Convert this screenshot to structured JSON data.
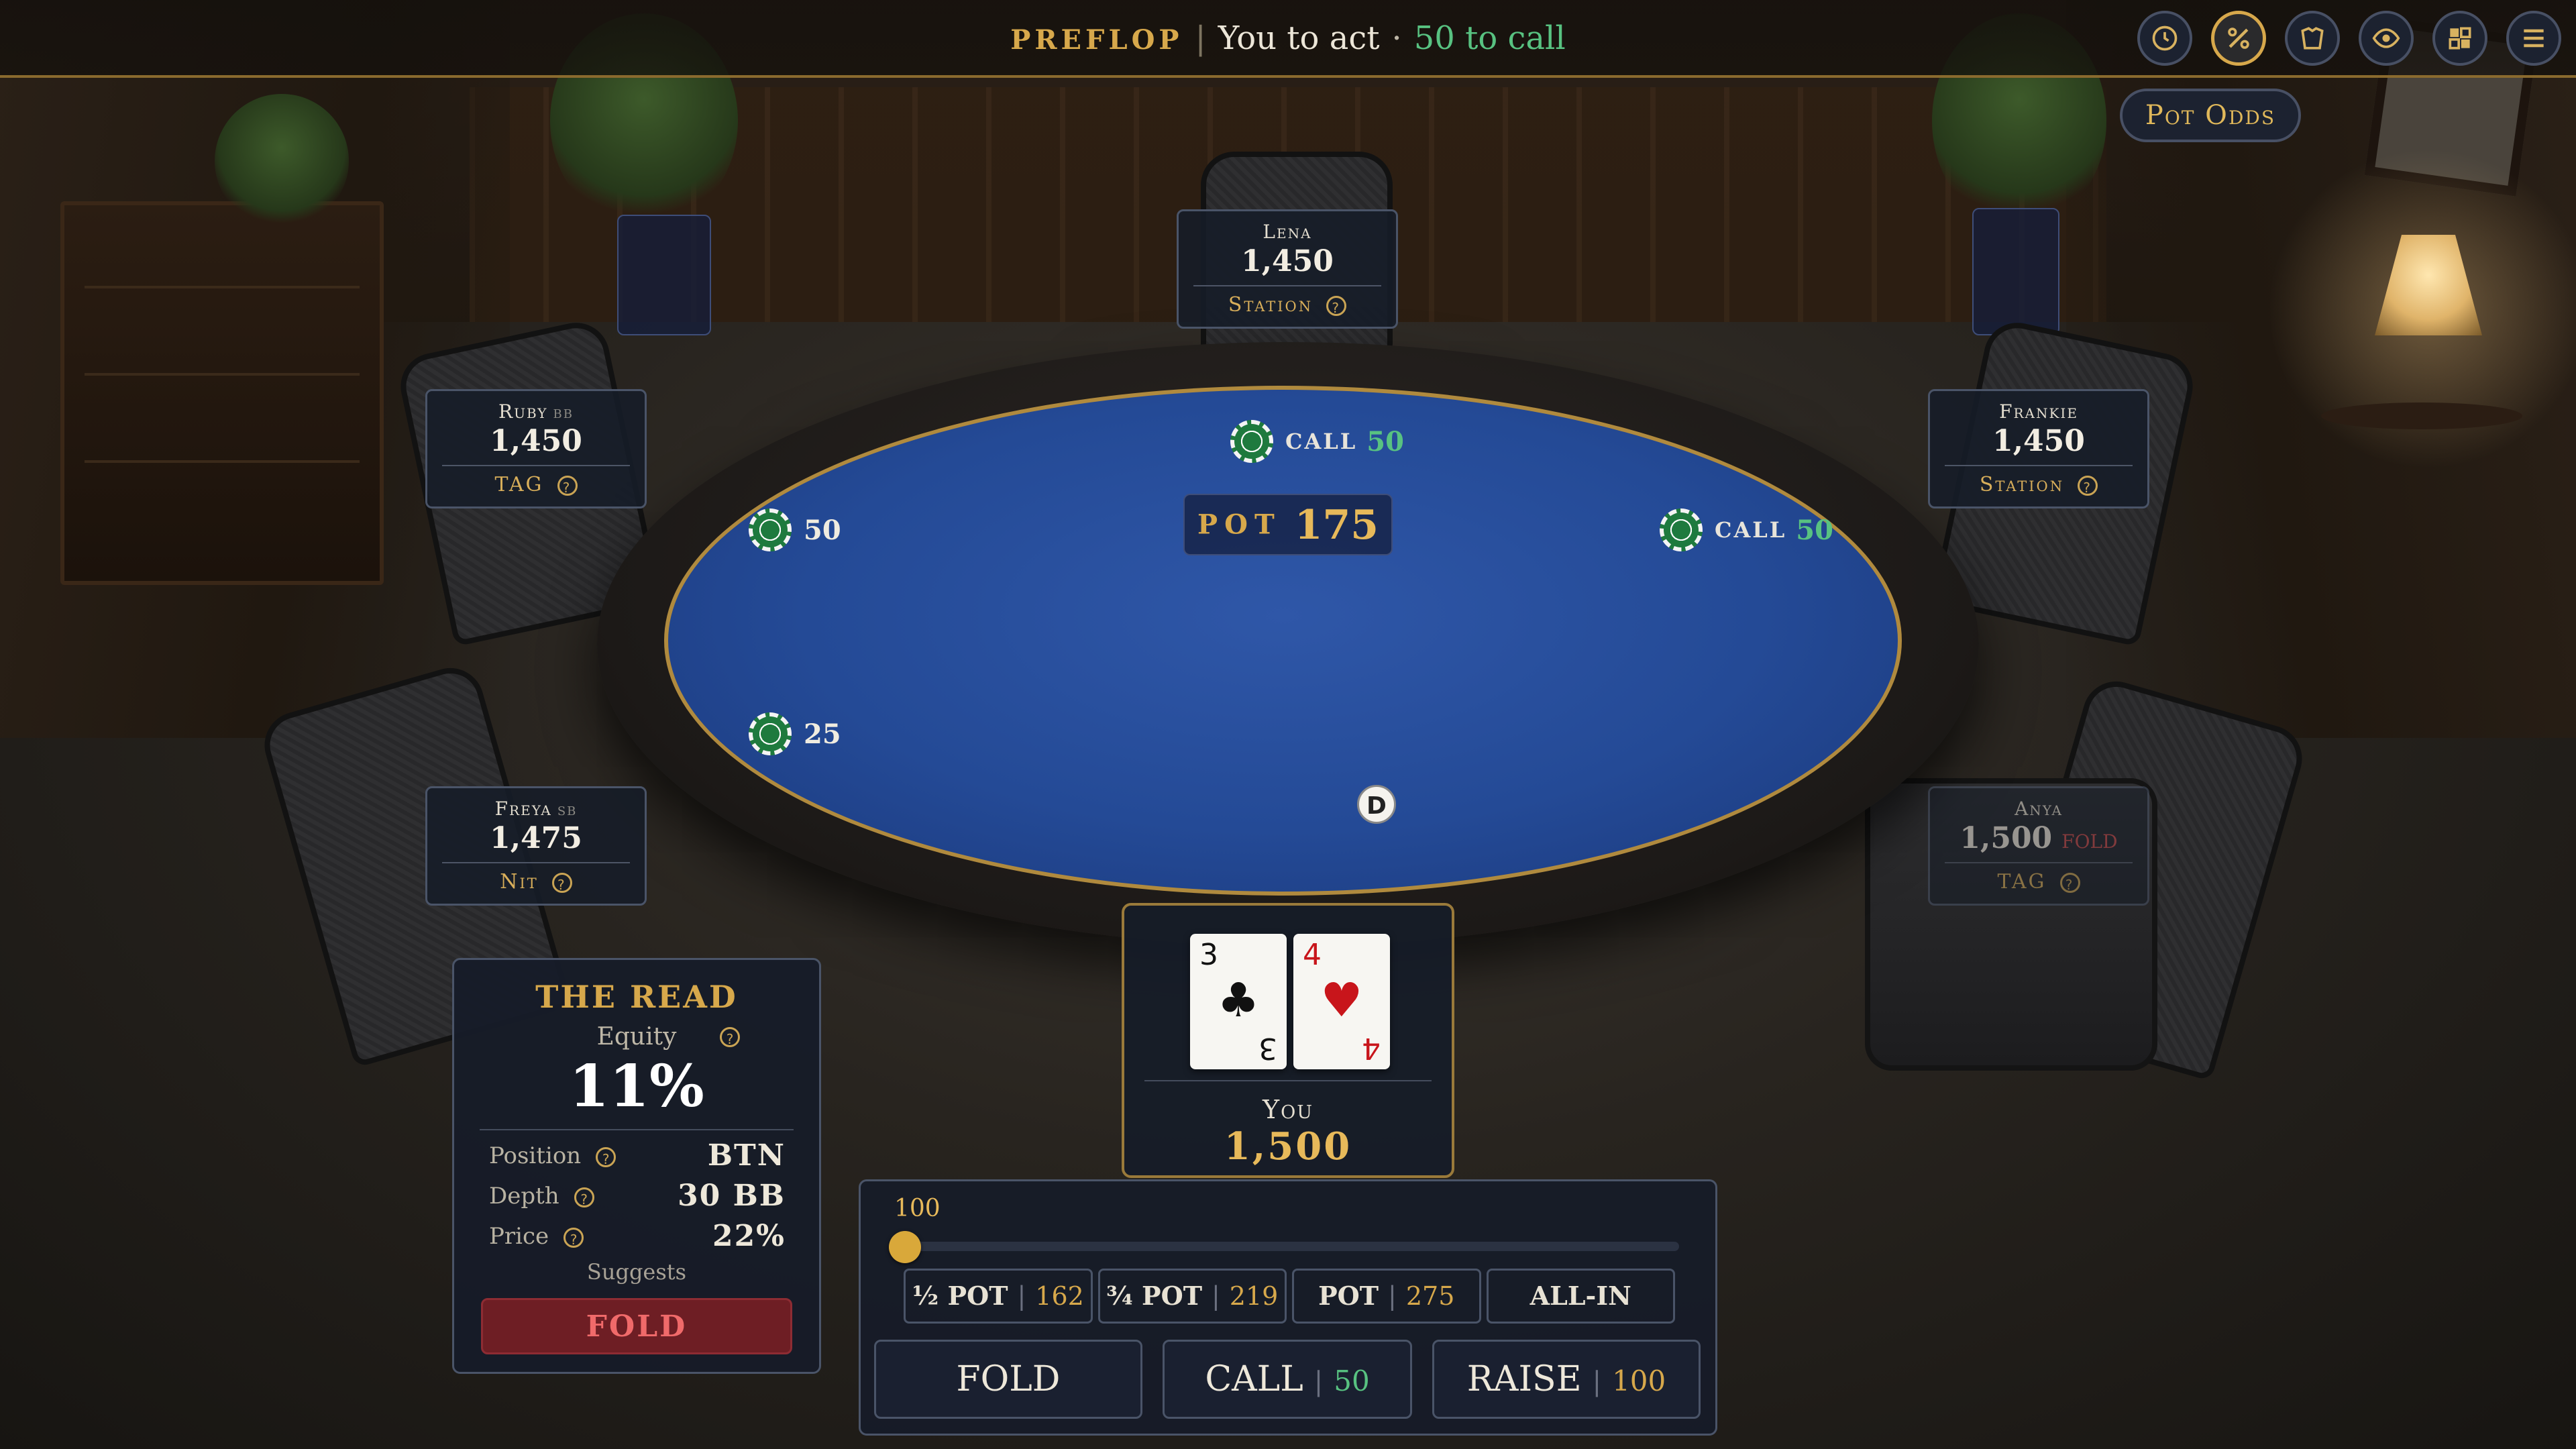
{
  "header": {
    "street": "PREFLOP",
    "status": "You to act",
    "to_call": "50 to call",
    "toolbar_icons": [
      "clock-icon",
      "percent-icon",
      "hand-rankings-icon",
      "eye-icon",
      "layout-icon",
      "menu-icon"
    ],
    "active_icon": "percent-icon",
    "tooltip": "Pot Odds"
  },
  "players": {
    "lena": {
      "name": "Lena",
      "stack": "1,450",
      "tag": "Station"
    },
    "ruby": {
      "name": "Ruby",
      "position": "BB",
      "stack": "1,450",
      "tag": "TAG"
    },
    "frankie": {
      "name": "Frankie",
      "stack": "1,450",
      "tag": "Station"
    },
    "freya": {
      "name": "Freya",
      "position": "SB",
      "stack": "1,475",
      "tag": "Nit"
    },
    "anya": {
      "name": "Anya",
      "stack": "1,500",
      "status": "FOLD",
      "tag": "TAG"
    }
  },
  "bets": {
    "lena": {
      "label": "CALL",
      "amount": "50"
    },
    "ruby": {
      "amount": "50"
    },
    "frankie": {
      "label": "CALL",
      "amount": "50"
    },
    "freya": {
      "amount": "25"
    }
  },
  "pot": {
    "label": "POT",
    "amount": "175"
  },
  "dealer_button": "D",
  "hero": {
    "label": "You",
    "stack": "1,500",
    "cards": [
      {
        "rank": "3",
        "suit": "♣",
        "color": "black"
      },
      {
        "rank": "4",
        "suit": "♥",
        "color": "red"
      }
    ]
  },
  "read": {
    "title": "THE READ",
    "equity_label": "Equity",
    "equity_value": "11%",
    "rows": [
      {
        "label": "Position",
        "value": "BTN"
      },
      {
        "label": "Depth",
        "value": "30 BB"
      },
      {
        "label": "Price",
        "value": "22%"
      }
    ],
    "suggests_label": "Suggests",
    "suggestion": "FOLD"
  },
  "action": {
    "slider_value": "100",
    "slider_fraction": 0.0,
    "presets": [
      {
        "label": "½ POT",
        "value": "162"
      },
      {
        "label": "¾ POT",
        "value": "219"
      },
      {
        "label": "POT",
        "value": "275"
      },
      {
        "label": "ALL-IN",
        "value": ""
      }
    ],
    "fold_label": "FOLD",
    "call_label": "CALL",
    "call_value": "50",
    "raise_label": "RAISE",
    "raise_value": "100"
  },
  "colors": {
    "accent_gold": "#d7a84b",
    "call_green": "#58c281",
    "fold_red": "#c9484a",
    "felt_blue": "#244a96"
  }
}
